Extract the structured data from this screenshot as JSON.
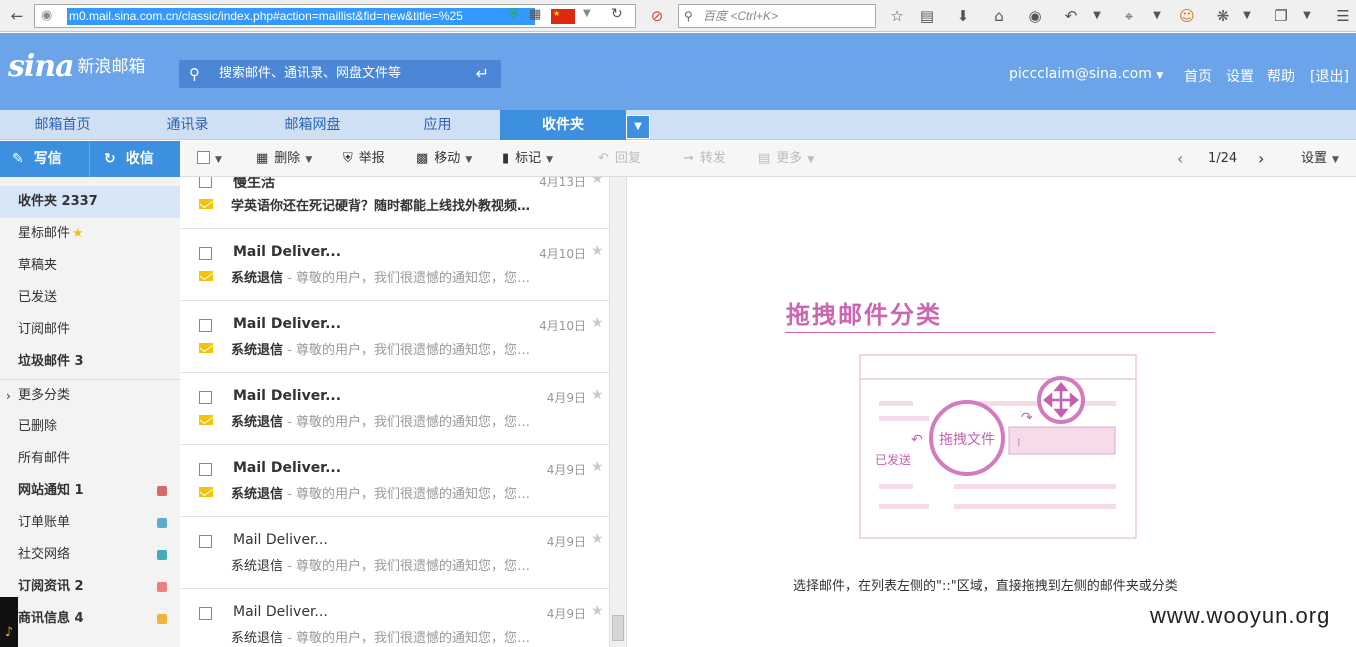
{
  "browser": {
    "url": "m0.mail.sina.com.cn/classic/index.php#action=maillist&fid=new&title=%25",
    "search_placeholder": "百度 <Ctrl+K>"
  },
  "header": {
    "logo_text": "sina",
    "logo_subtext": "新浪邮箱",
    "search_placeholder": "搜索邮件、通讯录、网盘文件等",
    "user_email": "piccclaim@sina.com",
    "links": {
      "home": "首页",
      "settings": "设置",
      "help": "帮助",
      "logout": "[退出]"
    }
  },
  "nav": {
    "tabs": [
      {
        "label": "邮箱首页"
      },
      {
        "label": "通讯录"
      },
      {
        "label": "邮箱网盘"
      },
      {
        "label": "应用"
      },
      {
        "label": "收件夹"
      }
    ]
  },
  "actions": {
    "compose": "写信",
    "receive": "收信"
  },
  "toolbar": {
    "delete": "删除",
    "report": "举报",
    "move": "移动",
    "mark": "标记",
    "reply": "回复",
    "forward": "转发",
    "more": "更多",
    "pagination": "1/24",
    "settings": "设置"
  },
  "sidebar": {
    "folders": [
      {
        "label": "收件夹 2337"
      },
      {
        "label": "星标邮件"
      },
      {
        "label": "草稿夹"
      },
      {
        "label": "已发送"
      },
      {
        "label": "订阅邮件"
      },
      {
        "label": "垃圾邮件 3"
      },
      {
        "label": "更多分类"
      },
      {
        "label": "已删除"
      },
      {
        "label": "所有邮件"
      },
      {
        "label": "网站通知 1"
      },
      {
        "label": "订单账单"
      },
      {
        "label": "社交网络"
      },
      {
        "label": "订阅资讯 2"
      },
      {
        "label": "商讯信息 4"
      }
    ],
    "colors": {
      "notice": "#d9686a",
      "orders": "#5aaecb",
      "social": "#45adb5",
      "news": "#ef7e7e",
      "business": "#f6b13a"
    }
  },
  "mails": [
    {
      "sender": "慢生活",
      "date": "4月13日",
      "subject": "学英语你还在死记硬背？随时都能上线找外教视频…",
      "preview": ""
    },
    {
      "sender": "Mail Deliver...",
      "date": "4月10日",
      "subject": "系统退信",
      "preview": " - 尊敬的用户，我们很遗憾的通知您，您…"
    },
    {
      "sender": "Mail Deliver...",
      "date": "4月10日",
      "subject": "系统退信",
      "preview": " - 尊敬的用户，我们很遗憾的通知您，您…"
    },
    {
      "sender": "Mail Deliver...",
      "date": "4月9日",
      "subject": "系统退信",
      "preview": " - 尊敬的用户，我们很遗憾的通知您，您…"
    },
    {
      "sender": "Mail Deliver...",
      "date": "4月9日",
      "subject": "系统退信",
      "preview": " - 尊敬的用户，我们很遗憾的通知您，您…"
    },
    {
      "sender": "Mail Deliver...",
      "date": "4月9日",
      "subject": "系统退信",
      "preview": " - 尊敬的用户，我们很遗憾的通知您，您…"
    },
    {
      "sender": "Mail Deliver...",
      "date": "4月9日",
      "subject": "系统退信",
      "preview": " - 尊敬的用户，我们很遗憾的通知您，您…"
    }
  ],
  "hint": {
    "title": "拖拽邮件分类",
    "illus_drag": "拖拽文件",
    "illus_sent": "已发送",
    "text": "选择邮件，在列表左侧的\"::\"区域，直接拖拽到左侧的邮件夹或分类"
  },
  "watermark": "www.wooyun.org",
  "colors": {
    "brand": "#6ba4e8",
    "accent": "#3d8fe0",
    "hint": "#cc66b3"
  }
}
